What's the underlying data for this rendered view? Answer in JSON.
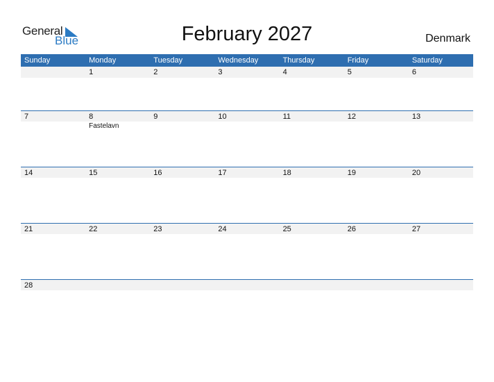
{
  "logo": {
    "line1": "General",
    "line2": "Blue"
  },
  "title": "February 2027",
  "country": "Denmark",
  "colors": {
    "header": "#2e6eb0",
    "strip": "#f2f2f2",
    "brand": "#2b7bc4"
  },
  "weekdays": [
    "Sunday",
    "Monday",
    "Tuesday",
    "Wednesday",
    "Thursday",
    "Friday",
    "Saturday"
  ],
  "weeks": [
    {
      "days": [
        "",
        "1",
        "2",
        "3",
        "4",
        "5",
        "6"
      ],
      "events": [
        "",
        "",
        "",
        "",
        "",
        "",
        ""
      ]
    },
    {
      "days": [
        "7",
        "8",
        "9",
        "10",
        "11",
        "12",
        "13"
      ],
      "events": [
        "",
        "Fastelavn",
        "",
        "",
        "",
        "",
        ""
      ]
    },
    {
      "days": [
        "14",
        "15",
        "16",
        "17",
        "18",
        "19",
        "20"
      ],
      "events": [
        "",
        "",
        "",
        "",
        "",
        "",
        ""
      ]
    },
    {
      "days": [
        "21",
        "22",
        "23",
        "24",
        "25",
        "26",
        "27"
      ],
      "events": [
        "",
        "",
        "",
        "",
        "",
        "",
        ""
      ]
    },
    {
      "days": [
        "28",
        "",
        "",
        "",
        "",
        "",
        ""
      ],
      "events": [
        "",
        "",
        "",
        "",
        "",
        "",
        ""
      ]
    }
  ]
}
